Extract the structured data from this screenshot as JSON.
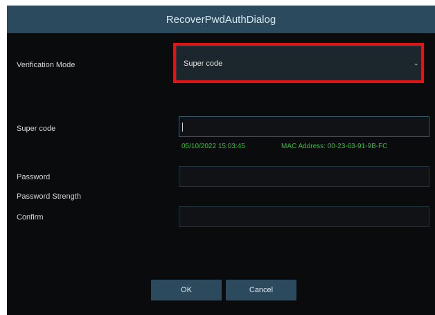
{
  "dialog": {
    "title": "RecoverPwdAuthDialog"
  },
  "verification": {
    "label": "Verification Mode",
    "selected": "Super code",
    "chevron_icon": "chevron-down-icon"
  },
  "super_code": {
    "label": "Super code",
    "value": "",
    "datetime": "05/10/2022 15:03:45",
    "mac": "MAC Address: 00-23-63-91-9B-FC"
  },
  "password": {
    "label": "Password",
    "value": ""
  },
  "strength": {
    "label": "Password Strength"
  },
  "confirm": {
    "label": "Confirm",
    "value": ""
  },
  "buttons": {
    "ok": "OK",
    "cancel": "Cancel"
  },
  "colors": {
    "titlebar": "#2b4a5e",
    "background": "#0a0b0d",
    "highlight": "#e11414",
    "info_text": "#2ec42e"
  }
}
